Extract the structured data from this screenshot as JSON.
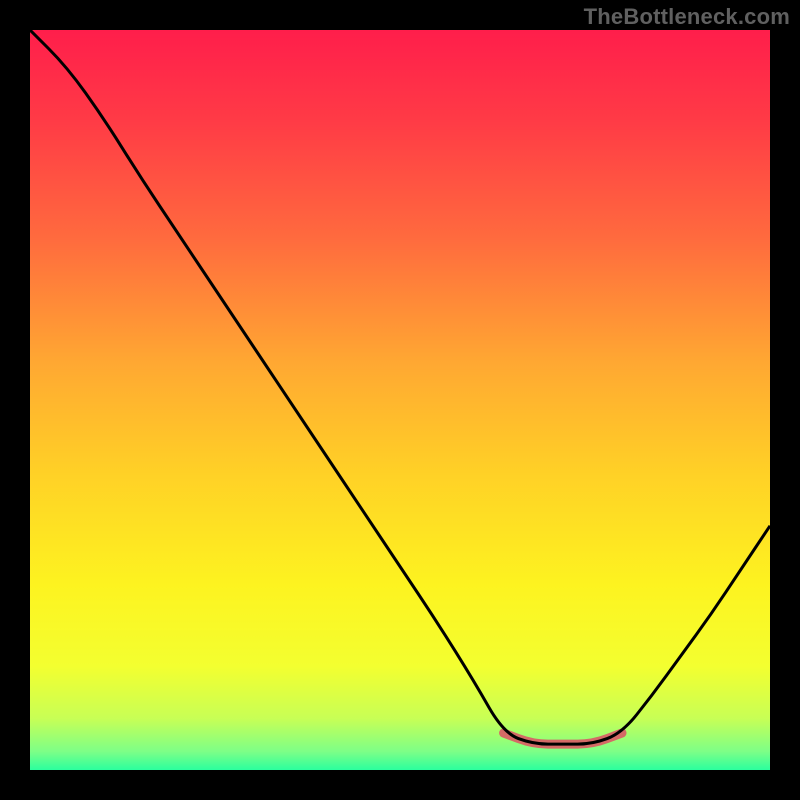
{
  "attribution": "TheBottleneck.com",
  "chart_data": {
    "type": "line",
    "title": "",
    "xlabel": "",
    "ylabel": "",
    "x": [
      0.0,
      0.05,
      0.1,
      0.15,
      0.2,
      0.25,
      0.3,
      0.35,
      0.4,
      0.45,
      0.5,
      0.55,
      0.6,
      0.64,
      0.68,
      0.72,
      0.76,
      0.8,
      0.84,
      0.88,
      0.92,
      0.96,
      1.0
    ],
    "values": [
      1.0,
      0.95,
      0.88,
      0.8,
      0.725,
      0.65,
      0.575,
      0.5,
      0.425,
      0.35,
      0.275,
      0.2,
      0.12,
      0.05,
      0.035,
      0.035,
      0.035,
      0.05,
      0.1,
      0.155,
      0.21,
      0.27,
      0.33
    ],
    "highlight_range_x": [
      0.62,
      0.8
    ],
    "xlim": [
      0,
      1
    ],
    "ylim": [
      0,
      1
    ],
    "gradient_stops": [
      {
        "offset": 0.0,
        "color": "#ff1e4b"
      },
      {
        "offset": 0.12,
        "color": "#ff3a46"
      },
      {
        "offset": 0.28,
        "color": "#ff6a3e"
      },
      {
        "offset": 0.45,
        "color": "#ffa832"
      },
      {
        "offset": 0.6,
        "color": "#ffd126"
      },
      {
        "offset": 0.75,
        "color": "#fdf320"
      },
      {
        "offset": 0.86,
        "color": "#f3ff30"
      },
      {
        "offset": 0.93,
        "color": "#c8ff55"
      },
      {
        "offset": 0.975,
        "color": "#7dff87"
      },
      {
        "offset": 1.0,
        "color": "#2bff9e"
      }
    ],
    "curve_stroke": "#000000",
    "highlight_stroke": "#d46a66"
  }
}
